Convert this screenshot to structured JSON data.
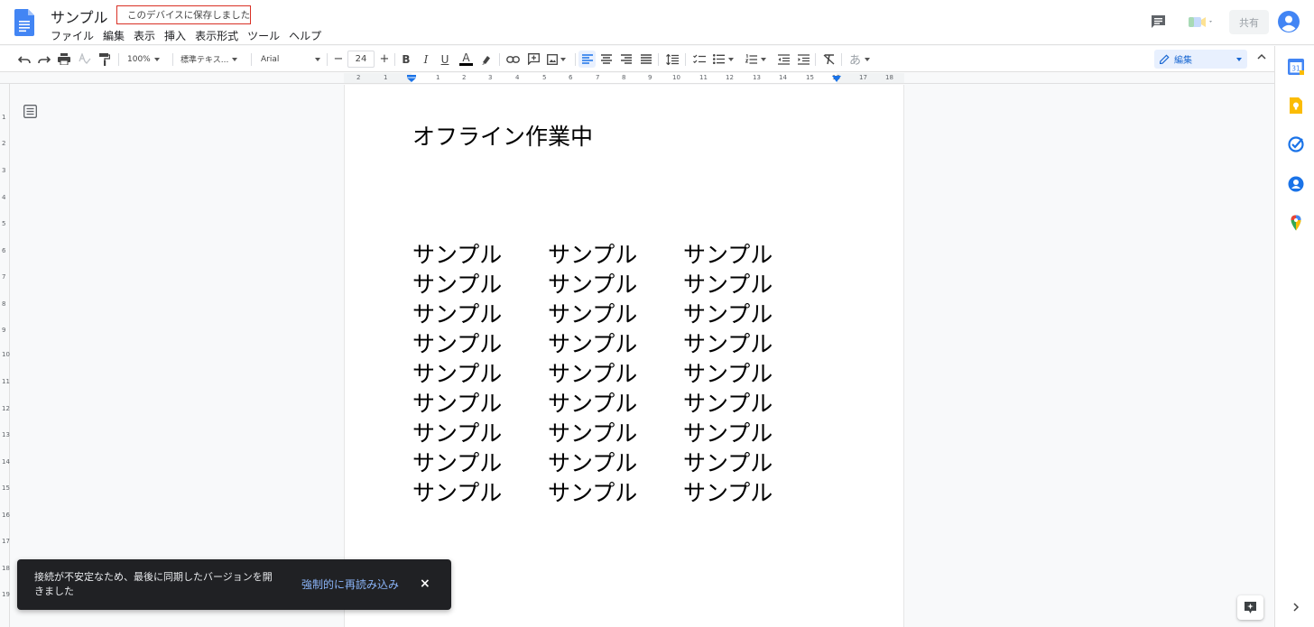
{
  "header": {
    "doc_title": "サンプル",
    "save_status": "このデバイスに保存しました",
    "share_label": "共有",
    "menu": [
      "ファイル",
      "編集",
      "表示",
      "挿入",
      "表示形式",
      "ツール",
      "ヘルプ"
    ]
  },
  "toolbar": {
    "zoom": "100%",
    "style": "標準テキス...",
    "font": "Arial",
    "font_size": "24",
    "mode_label": "編集",
    "ime_label": "あ",
    "bold": "B",
    "italic": "I",
    "underline": "U",
    "text_color": "A",
    "font_size_minus": "−",
    "font_size_plus": "+"
  },
  "ruler": {
    "h_labels": [
      "2",
      "1",
      "1",
      "2",
      "3",
      "4",
      "5",
      "6",
      "7",
      "8",
      "9",
      "10",
      "11",
      "12",
      "13",
      "14",
      "15",
      "16",
      "17",
      "18"
    ],
    "v_labels": [
      "1",
      "2",
      "3",
      "4",
      "5",
      "6",
      "7",
      "8",
      "9",
      "10",
      "11",
      "12",
      "13",
      "14",
      "15",
      "16",
      "17",
      "18",
      "19"
    ]
  },
  "document": {
    "heading": "オフライン作業中",
    "rows": [
      [
        "サンプル",
        "サンプル",
        "サンプル"
      ],
      [
        "サンプル",
        "サンプル",
        "サンプル"
      ],
      [
        "サンプル",
        "サンプル",
        "サンプル"
      ],
      [
        "サンプル",
        "サンプル",
        "サンプル"
      ],
      [
        "サンプル",
        "サンプル",
        "サンプル"
      ],
      [
        "サンプル",
        "サンプル",
        "サンプル"
      ],
      [
        "サンプル",
        "サンプル",
        "サンプル"
      ],
      [
        "サンプル",
        "サンプル",
        "サンプル"
      ],
      [
        "サンプル",
        "サンプル",
        "サンプル"
      ]
    ]
  },
  "snackbar": {
    "message": "接続が不安定なため、最後に同期したバージョンを開きました",
    "action": "強制的に再読み込み",
    "close": "×"
  },
  "sidepanel": {
    "calendar_day": "31"
  },
  "colors": {
    "docs_blue": "#4285f4",
    "accent": "#1a73e8",
    "status_border": "#d93025",
    "snackbar_bg": "#202124",
    "snackbar_action": "#8ab4f8"
  },
  "icons": {
    "logo": "docs-logo-icon",
    "comments": "comment-icon",
    "meet": "meet-icon",
    "account": "account-avatar-icon",
    "outline": "outline-icon",
    "explore": "explore-icon"
  }
}
